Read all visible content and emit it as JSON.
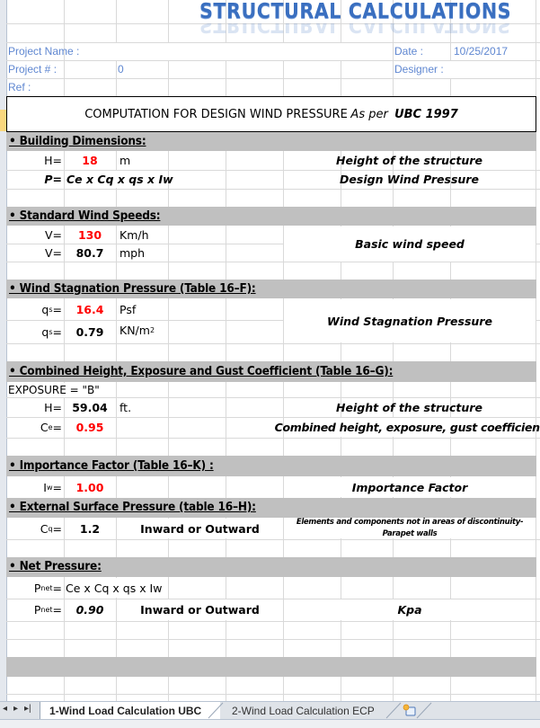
{
  "title": "STRUCTURAL CALCULATIONS",
  "project": {
    "name_label": "Project Name :",
    "number_label": "Project # :",
    "number_value": "0",
    "ref_label": "Ref :",
    "date_label": "Date :",
    "date_value": "10/25/2017",
    "designer_label": "Designer :"
  },
  "header": {
    "main": "COMPUTATION FOR DESIGN WIND PRESSURE",
    "as_per": "As per",
    "code": "UBC 1997"
  },
  "sections": {
    "building": {
      "title": "• Building Dimensions:",
      "h_label": "H=",
      "h_value": "18",
      "h_unit": "m",
      "h_desc": "Height of the structure",
      "p_label": "P=",
      "p_formula": "Ce x Cq x qs x Iw",
      "p_desc": "Design Wind Pressure"
    },
    "wind_speed": {
      "title": "• Standard Wind Speeds:",
      "v1_label": "V=",
      "v1_value": "130",
      "v1_unit": "Km/h",
      "v2_label": "V=",
      "v2_value": "80.7",
      "v2_unit": "mph",
      "desc": "Basic wind speed"
    },
    "stagnation": {
      "title": "• Wind Stagnation Pressure (Table 16–F):",
      "q1_label": "q",
      "q1_sub": "s",
      "q1_value": "16.4",
      "q1_unit": "Psf",
      "q2_label": "q",
      "q2_sub": "s",
      "q2_value": "0.79",
      "q2_unit": "KN/m",
      "q2_unit_sup": "2",
      "desc": "Wind Stagnation Pressure"
    },
    "combined": {
      "title": "• Combined Height, Exposure and Gust Coefficient (Table 16–G):",
      "exposure": "EXPOSURE =  \"B\"",
      "h_label": "H=",
      "h_value": "59.04",
      "h_unit": "ft.",
      "h_desc": "Height of the structure",
      "ce_label": "C",
      "ce_sub": "e",
      "ce_value": "0.95",
      "ce_desc": "Combined height, exposure, gust coefficient"
    },
    "importance": {
      "title": "• Importance Factor (Table 16–K) :",
      "iw_label": "I",
      "iw_sub": "w",
      "iw_value": "1.00",
      "desc": "Importance Factor"
    },
    "external": {
      "title": "• External Surface Pressure (table 16–H):",
      "cq_label": "C",
      "cq_sub": "q",
      "cq_value": "1.2",
      "direction": "Inward or Outward",
      "desc_line1": "Elements and components not in areas of discontinuity-",
      "desc_line2": "Parapet walls"
    },
    "net": {
      "title": "• Net Pressure:",
      "f_label": "P",
      "f_sub": "net",
      "formula": "Ce x Cq x qs x Iw",
      "p_label": "P",
      "p_sub": "net",
      "p_value": "0.90",
      "direction": "Inward or Outward",
      "unit": "Kpa"
    }
  },
  "tabs": {
    "nav_first": "◂",
    "nav_next": "▸",
    "nav_last": "▸|",
    "items": [
      {
        "label": "1-Wind Load Calculation UBC",
        "active": true
      },
      {
        "label": "2-Wind Load Calculation ECP",
        "active": false
      }
    ],
    "new_sheet_icon": "new-sheet-icon"
  }
}
